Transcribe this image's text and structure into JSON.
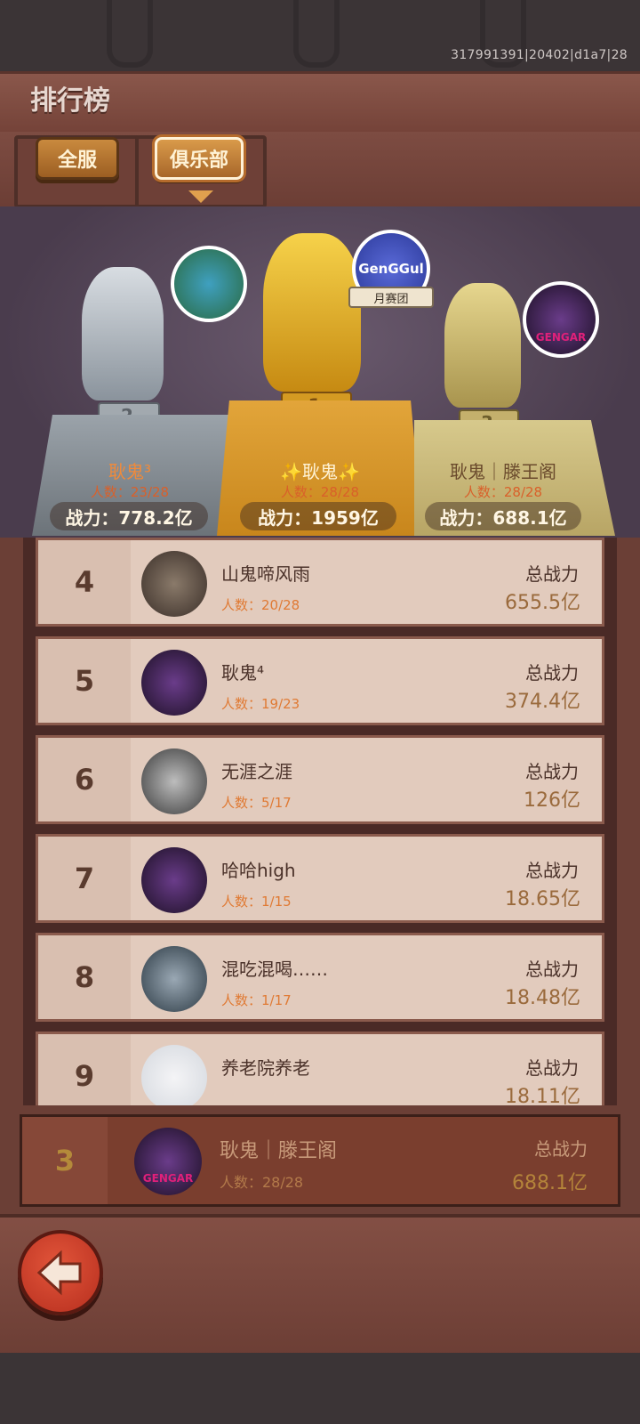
{
  "build_id": "317991391|20402|d1a7|28",
  "page_title": "排行榜",
  "tabs": [
    {
      "label": "全服",
      "active": false
    },
    {
      "label": "俱乐部",
      "active": true
    }
  ],
  "podium": {
    "first": {
      "rank": "1",
      "name": "✨耿鬼✨",
      "count": "人数：28/28",
      "power": "战力：1959亿",
      "badge": "月赛团",
      "avatar_text": "GenGGul"
    },
    "second": {
      "rank": "2",
      "name": "耿鬼³",
      "count": "人数：23/28",
      "power": "战力：778.2亿"
    },
    "third": {
      "rank": "3",
      "name": "耿鬼｜滕王阁",
      "count": "人数：28/28",
      "power": "战力：688.1亿",
      "avatar_text": "GENGAR"
    }
  },
  "list": {
    "power_label": "总战力",
    "rows": [
      {
        "rank": "4",
        "name": "山鬼啼风雨",
        "count": "人数：20/28",
        "power": "655.5亿",
        "avatar": "photo-couple"
      },
      {
        "rank": "5",
        "name": "耿鬼⁴",
        "count": "人数：19/23",
        "power": "374.4亿",
        "avatar": "gengar"
      },
      {
        "rank": "6",
        "name": "无涯之涯",
        "count": "人数：5/17",
        "power": "126亿",
        "avatar": "photo-bw"
      },
      {
        "rank": "7",
        "name": "哈哈high",
        "count": "人数：1/15",
        "power": "18.65亿",
        "avatar": "gengar"
      },
      {
        "rank": "8",
        "name": "混吃混喝……",
        "count": "人数：1/17",
        "power": "18.48亿",
        "avatar": "photo-scene"
      },
      {
        "rank": "9",
        "name": "养老院养老",
        "count": "",
        "power": "18.11亿",
        "avatar": "default"
      }
    ]
  },
  "my_club": {
    "rank": "3",
    "name": "耿鬼｜滕王阁",
    "count": "人数：28/28",
    "power_label": "总战力",
    "power": "688.1亿",
    "avatar_text": "GENGAR"
  },
  "colors": {
    "accent_orange": "#e07a34",
    "wood": "#7d4c42",
    "gold": "#e2a53a",
    "silver": "#9ba3aa",
    "bronze": "#d7c98c"
  },
  "icons": {
    "back": "back-arrow-icon"
  }
}
